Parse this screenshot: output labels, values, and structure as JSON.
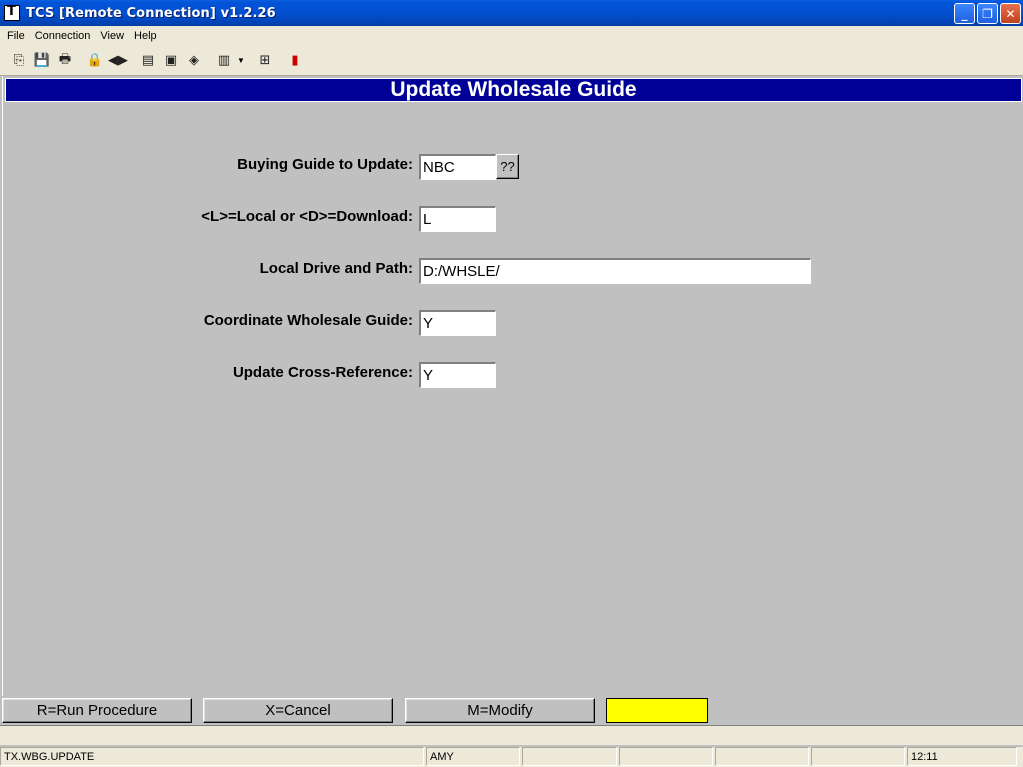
{
  "window": {
    "title": "TCS [Remote Connection]  v1.2.26",
    "minimize": "_",
    "restore": "❐",
    "close": "✕"
  },
  "menu": [
    "File",
    "Connection",
    "View",
    "Help"
  ],
  "toolbar": {
    "icons": [
      "copy-icon",
      "save-icon",
      "print-icon",
      "lock-icon",
      "speaker-icon",
      "properties-icon",
      "monitor-icon",
      "book-icon",
      "document-icon",
      "tree-icon",
      "chart-icon"
    ]
  },
  "form": {
    "heading": "Update Wholesale Guide",
    "fields": [
      {
        "label": "Buying Guide to Update:",
        "value": "NBC"
      },
      {
        "label": "<L>=Local or <D>=Download:",
        "value": "L"
      },
      {
        "label": "Local Drive and Path:",
        "value": "D:/WHSLE/"
      },
      {
        "label": "Coordinate Wholesale Guide:",
        "value": "Y"
      },
      {
        "label": "Update Cross-Reference:",
        "value": "Y"
      }
    ],
    "lookup_label": "??"
  },
  "footer": {
    "run": "R=Run Procedure",
    "cancel": "X=Cancel",
    "modify": "M=Modify",
    "highlight_color": "#ffff00"
  },
  "status": {
    "procedure": "TX.WBG.UPDATE",
    "user": "AMY",
    "time": "12:11"
  }
}
